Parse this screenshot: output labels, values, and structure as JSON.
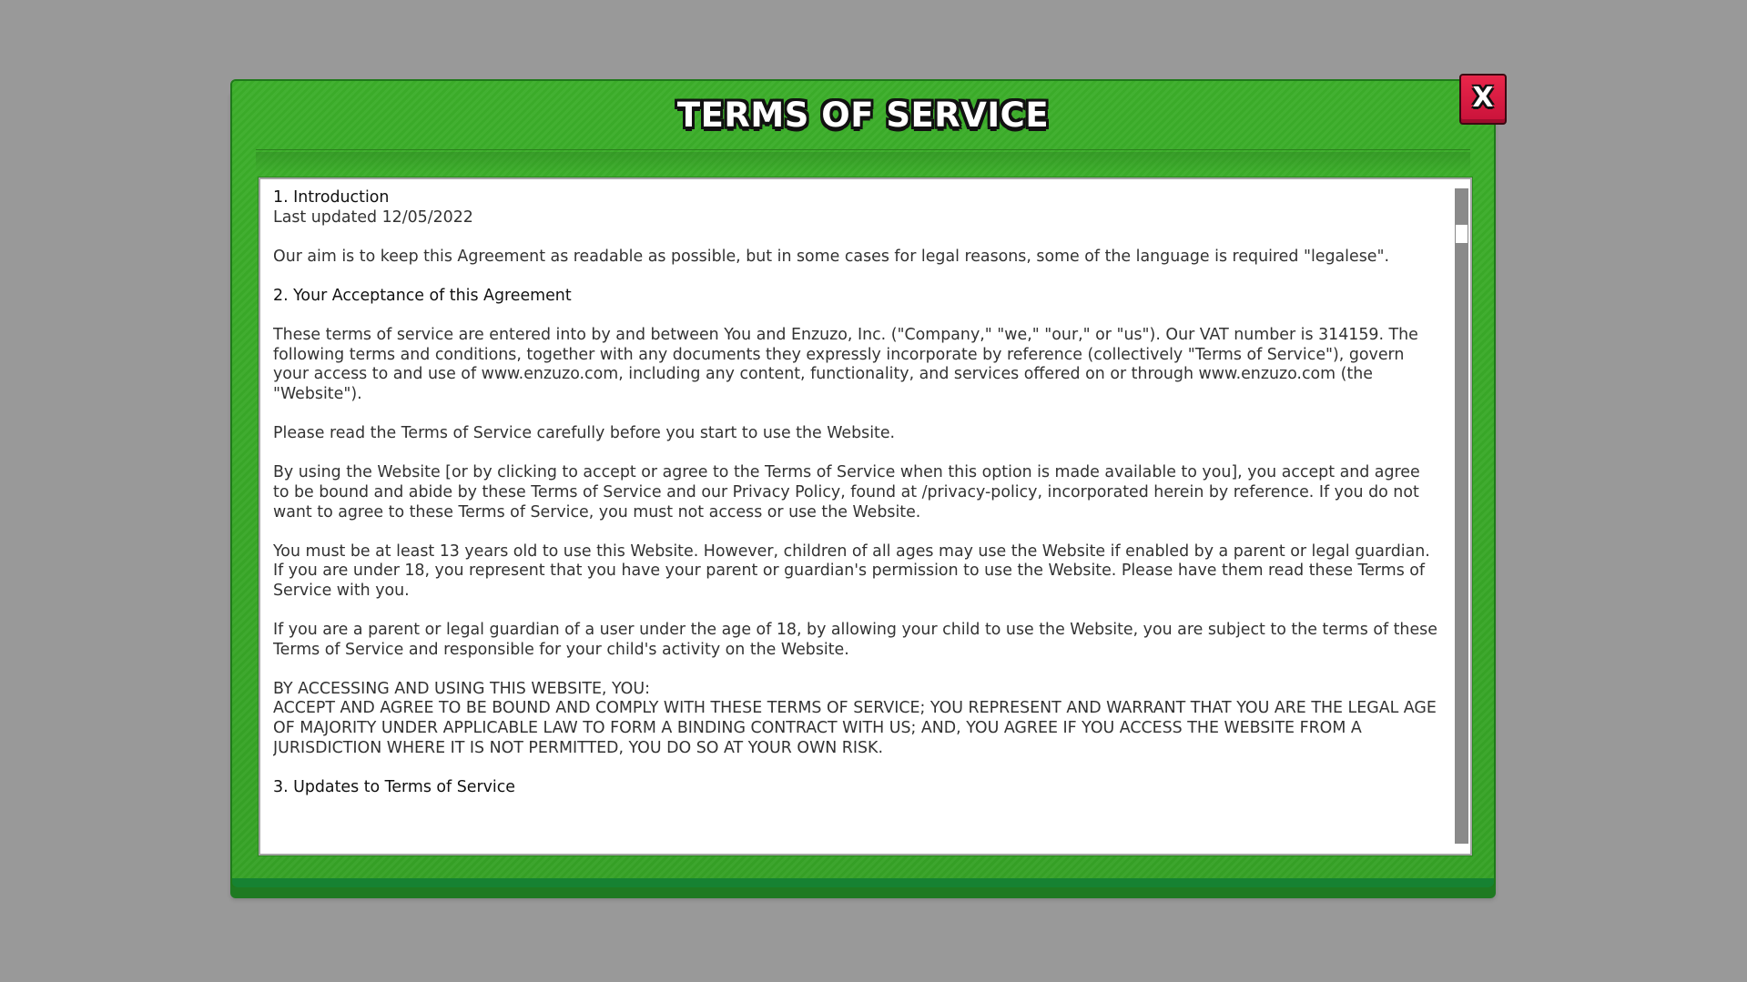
{
  "dialog": {
    "title": "TERMS OF SERVICE",
    "close_label": "X"
  },
  "content": {
    "section1_heading": "1. Introduction",
    "last_updated": "Last updated 12/05/2022",
    "intro_paragraph": "Our aim is to keep this Agreement as readable as possible, but in some cases for legal reasons, some of the language is required \"legalese\".",
    "section2_heading": "2. Your Acceptance of this Agreement",
    "para_terms_entered": "These terms of service are entered into by and between You and Enzuzo, Inc. (\"Company,\" \"we,\" \"our,\" or \"us\"). Our VAT number is 314159. The following terms and conditions, together with any documents they expressly incorporate by reference (collectively \"Terms of Service\"), govern your access to and use of www.enzuzo.com, including any content, functionality, and services offered on or through www.enzuzo.com (the \"Website\").",
    "para_read_carefully": "Please read the Terms of Service carefully before you start to use the Website.",
    "para_by_using": "By using the Website [or by clicking to accept or agree to the Terms of Service when this option is made available to you], you accept and agree to be bound and abide by these Terms of Service and our Privacy Policy, found at /privacy-policy, incorporated herein by reference. If you do not want to agree to these Terms of Service, you must not access or use the Website.",
    "para_age": "You must be at least 13 years old to use this Website. However, children of all ages may use the Website if enabled by a parent or legal guardian. If you are under 18, you represent that you have your parent or guardian's permission to use the Website. Please have them read these Terms of Service with you.",
    "para_parent": "If you are a parent or legal guardian of a user under the age of 18, by allowing your child to use the Website, you are subject to the terms of these Terms of Service and responsible for your child's activity on the Website.",
    "caps_line1": "BY ACCESSING AND USING THIS WEBSITE, YOU:",
    "caps_line2": "ACCEPT AND AGREE TO BE BOUND AND COMPLY WITH THESE TERMS OF SERVICE; YOU REPRESENT AND WARRANT THAT YOU ARE THE LEGAL AGE OF MAJORITY UNDER APPLICABLE LAW TO FORM A BINDING CONTRACT WITH US; AND, YOU AGREE IF YOU ACCESS THE WEBSITE FROM A JURISDICTION WHERE IT IS NOT PERMITTED, YOU DO SO AT YOUR OWN RISK.",
    "section3_heading": "3. Updates to Terms of Service"
  },
  "colors": {
    "backdrop": "#999999",
    "panel_green": "#3ba62a",
    "panel_shadow": "#168232",
    "close_red": "#e01e44",
    "scrollbar": "#8a8a8a"
  }
}
